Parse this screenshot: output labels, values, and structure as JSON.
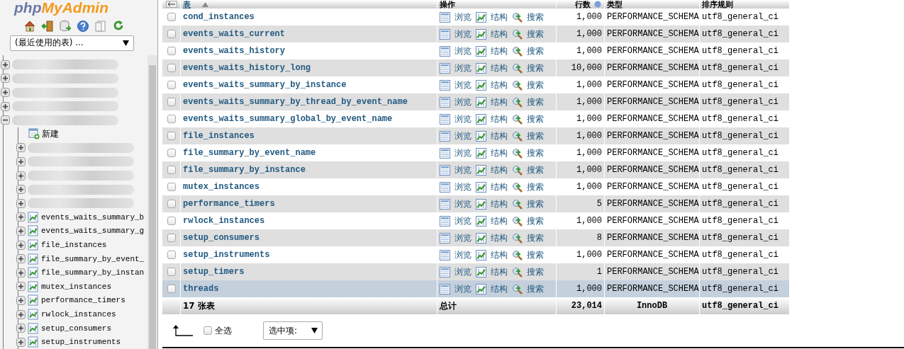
{
  "sidebar": {
    "logo": [
      "php",
      "MyAdmin"
    ],
    "recent_select": {
      "value": "(最近使用的表) ..."
    },
    "tree": [
      {
        "kind": "redacted",
        "expanded": false
      },
      {
        "kind": "redacted",
        "expanded": false
      },
      {
        "kind": "redacted",
        "expanded": false
      },
      {
        "kind": "redacted",
        "expanded": false
      },
      {
        "kind": "redacted",
        "expanded": true,
        "children": [
          {
            "kind": "new",
            "label": "新建"
          },
          {
            "kind": "redacted",
            "expanded": false
          },
          {
            "kind": "redacted",
            "expanded": false
          },
          {
            "kind": "redacted",
            "expanded": false
          },
          {
            "kind": "redacted",
            "expanded": false
          },
          {
            "kind": "redacted",
            "expanded": false
          },
          {
            "kind": "table",
            "label": "events_waits_summary_b",
            "expanded": false
          },
          {
            "kind": "table",
            "label": "events_waits_summary_g",
            "expanded": false
          },
          {
            "kind": "table",
            "label": "file_instances",
            "expanded": false
          },
          {
            "kind": "table",
            "label": "file_summary_by_event_",
            "expanded": false
          },
          {
            "kind": "table",
            "label": "file_summary_by_instan",
            "expanded": false
          },
          {
            "kind": "table",
            "label": "mutex_instances",
            "expanded": false
          },
          {
            "kind": "table",
            "label": "performance_timers",
            "expanded": false
          },
          {
            "kind": "table",
            "label": "rwlock_instances",
            "expanded": false
          },
          {
            "kind": "table",
            "label": "setup_consumers",
            "expanded": false
          },
          {
            "kind": "table",
            "label": "setup_instruments",
            "expanded": false
          }
        ]
      }
    ]
  },
  "table": {
    "columns": [
      "表",
      "操作",
      "行数",
      "类型",
      "排序规则"
    ],
    "rows": [
      {
        "name": "cond_instances",
        "actions": [
          "浏览",
          "结构",
          "搜索"
        ],
        "rows": "1,000",
        "type": "PERFORMANCE_SCHEMA",
        "collation": "utf8_general_ci",
        "checked": false,
        "highlighted": false
      },
      {
        "name": "events_waits_current",
        "actions": [
          "浏览",
          "结构",
          "搜索"
        ],
        "rows": "1,000",
        "type": "PERFORMANCE_SCHEMA",
        "collation": "utf8_general_ci",
        "checked": false,
        "highlighted": false
      },
      {
        "name": "events_waits_history",
        "actions": [
          "浏览",
          "结构",
          "搜索"
        ],
        "rows": "1,000",
        "type": "PERFORMANCE_SCHEMA",
        "collation": "utf8_general_ci",
        "checked": false,
        "highlighted": false
      },
      {
        "name": "events_waits_history_long",
        "actions": [
          "浏览",
          "结构",
          "搜索"
        ],
        "rows": "10,000",
        "type": "PERFORMANCE_SCHEMA",
        "collation": "utf8_general_ci",
        "checked": false,
        "highlighted": false
      },
      {
        "name": "events_waits_summary_by_instance",
        "actions": [
          "浏览",
          "结构",
          "搜索"
        ],
        "rows": "1,000",
        "type": "PERFORMANCE_SCHEMA",
        "collation": "utf8_general_ci",
        "checked": false,
        "highlighted": false
      },
      {
        "name": "events_waits_summary_by_thread_by_event_name",
        "actions": [
          "浏览",
          "结构",
          "搜索"
        ],
        "rows": "1,000",
        "type": "PERFORMANCE_SCHEMA",
        "collation": "utf8_general_ci",
        "checked": false,
        "highlighted": false
      },
      {
        "name": "events_waits_summary_global_by_event_name",
        "actions": [
          "浏览",
          "结构",
          "搜索"
        ],
        "rows": "1,000",
        "type": "PERFORMANCE_SCHEMA",
        "collation": "utf8_general_ci",
        "checked": false,
        "highlighted": false
      },
      {
        "name": "file_instances",
        "actions": [
          "浏览",
          "结构",
          "搜索"
        ],
        "rows": "1,000",
        "type": "PERFORMANCE_SCHEMA",
        "collation": "utf8_general_ci",
        "checked": false,
        "highlighted": false
      },
      {
        "name": "file_summary_by_event_name",
        "actions": [
          "浏览",
          "结构",
          "搜索"
        ],
        "rows": "1,000",
        "type": "PERFORMANCE_SCHEMA",
        "collation": "utf8_general_ci",
        "checked": false,
        "highlighted": false
      },
      {
        "name": "file_summary_by_instance",
        "actions": [
          "浏览",
          "结构",
          "搜索"
        ],
        "rows": "1,000",
        "type": "PERFORMANCE_SCHEMA",
        "collation": "utf8_general_ci",
        "checked": false,
        "highlighted": false
      },
      {
        "name": "mutex_instances",
        "actions": [
          "浏览",
          "结构",
          "搜索"
        ],
        "rows": "1,000",
        "type": "PERFORMANCE_SCHEMA",
        "collation": "utf8_general_ci",
        "checked": false,
        "highlighted": false
      },
      {
        "name": "performance_timers",
        "actions": [
          "浏览",
          "结构",
          "搜索"
        ],
        "rows": "5",
        "type": "PERFORMANCE_SCHEMA",
        "collation": "utf8_general_ci",
        "checked": false,
        "highlighted": false
      },
      {
        "name": "rwlock_instances",
        "actions": [
          "浏览",
          "结构",
          "搜索"
        ],
        "rows": "1,000",
        "type": "PERFORMANCE_SCHEMA",
        "collation": "utf8_general_ci",
        "checked": false,
        "highlighted": false
      },
      {
        "name": "setup_consumers",
        "actions": [
          "浏览",
          "结构",
          "搜索"
        ],
        "rows": "8",
        "type": "PERFORMANCE_SCHEMA",
        "collation": "utf8_general_ci",
        "checked": false,
        "highlighted": false
      },
      {
        "name": "setup_instruments",
        "actions": [
          "浏览",
          "结构",
          "搜索"
        ],
        "rows": "1,000",
        "type": "PERFORMANCE_SCHEMA",
        "collation": "utf8_general_ci",
        "checked": false,
        "highlighted": false
      },
      {
        "name": "setup_timers",
        "actions": [
          "浏览",
          "结构",
          "搜索"
        ],
        "rows": "1",
        "type": "PERFORMANCE_SCHEMA",
        "collation": "utf8_general_ci",
        "checked": false,
        "highlighted": false
      },
      {
        "name": "threads",
        "actions": [
          "浏览",
          "结构",
          "搜索"
        ],
        "rows": "1,000",
        "type": "PERFORMANCE_SCHEMA",
        "collation": "utf8_general_ci",
        "checked": false,
        "highlighted": true
      }
    ],
    "footer": {
      "count": "17 张表",
      "total_label": "总计",
      "rows": "23,014",
      "type": "InnoDB",
      "collation": "utf8_general_ci"
    }
  },
  "bulk": {
    "select_all": {
      "label": "全选",
      "checked": false
    },
    "with_selected": {
      "value": "选中项:"
    }
  }
}
